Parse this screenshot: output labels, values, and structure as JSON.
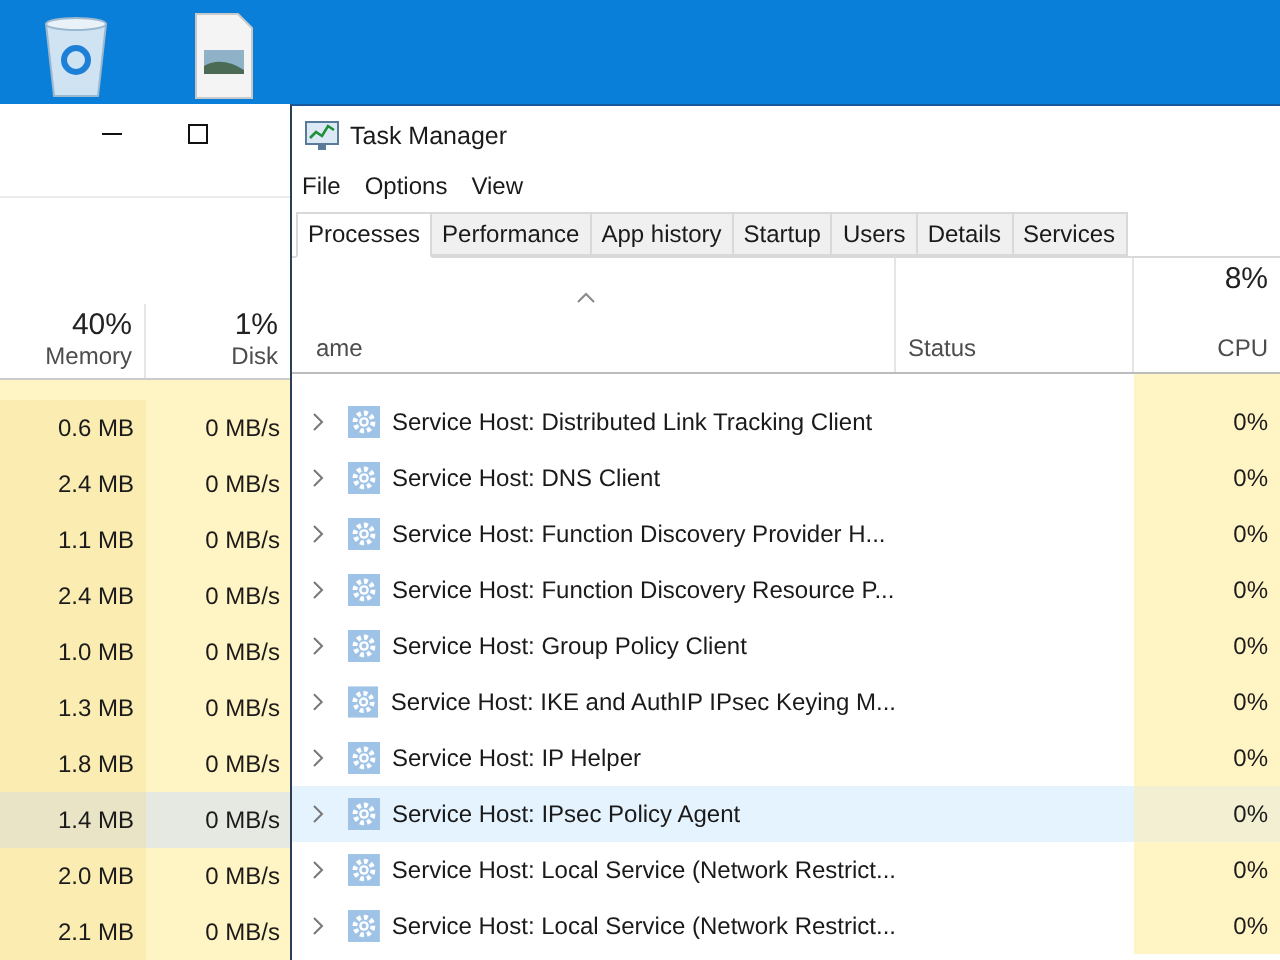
{
  "background_window": {
    "columns": [
      {
        "percent": "40%",
        "label": "Memory"
      },
      {
        "percent": "1%",
        "label": "Disk"
      }
    ],
    "rows": [
      {
        "memory": "0.6 MB",
        "disk": "0 MB/s",
        "selected": false
      },
      {
        "memory": "2.4 MB",
        "disk": "0 MB/s",
        "selected": false
      },
      {
        "memory": "1.1 MB",
        "disk": "0 MB/s",
        "selected": false
      },
      {
        "memory": "2.4 MB",
        "disk": "0 MB/s",
        "selected": false
      },
      {
        "memory": "1.0 MB",
        "disk": "0 MB/s",
        "selected": false
      },
      {
        "memory": "1.3 MB",
        "disk": "0 MB/s",
        "selected": false
      },
      {
        "memory": "1.8 MB",
        "disk": "0 MB/s",
        "selected": false
      },
      {
        "memory": "1.4 MB",
        "disk": "0 MB/s",
        "selected": true
      },
      {
        "memory": "2.0 MB",
        "disk": "0 MB/s",
        "selected": false
      },
      {
        "memory": "2.1 MB",
        "disk": "0 MB/s",
        "selected": false
      }
    ]
  },
  "window": {
    "title": "Task Manager"
  },
  "menu": [
    "File",
    "Options",
    "View"
  ],
  "tabs": [
    {
      "label": "Processes",
      "selected": true
    },
    {
      "label": "Performance",
      "selected": false
    },
    {
      "label": "App history",
      "selected": false
    },
    {
      "label": "Startup",
      "selected": false
    },
    {
      "label": "Users",
      "selected": false
    },
    {
      "label": "Details",
      "selected": false
    },
    {
      "label": "Services",
      "selected": false
    }
  ],
  "table": {
    "columns": [
      {
        "label": "ame"
      },
      {
        "label": "Status"
      },
      {
        "percent": "8%",
        "label": "CPU"
      }
    ],
    "rows": [
      {
        "name": "Service Host: Distributed Link Tracking Client",
        "cpu": "0%",
        "selected": false
      },
      {
        "name": "Service Host: DNS Client",
        "cpu": "0%",
        "selected": false
      },
      {
        "name": "Service Host: Function Discovery Provider H...",
        "cpu": "0%",
        "selected": false
      },
      {
        "name": "Service Host: Function Discovery Resource P...",
        "cpu": "0%",
        "selected": false
      },
      {
        "name": "Service Host: Group Policy Client",
        "cpu": "0%",
        "selected": false
      },
      {
        "name": "Service Host: IKE and AuthIP IPsec Keying M...",
        "cpu": "0%",
        "selected": false
      },
      {
        "name": "Service Host: IP Helper",
        "cpu": "0%",
        "selected": false
      },
      {
        "name": "Service Host: IPsec Policy Agent",
        "cpu": "0%",
        "selected": true
      },
      {
        "name": "Service Host: Local Service (Network Restrict...",
        "cpu": "0%",
        "selected": false
      },
      {
        "name": "Service Host: Local Service (Network Restrict...",
        "cpu": "0%",
        "selected": false
      }
    ]
  }
}
